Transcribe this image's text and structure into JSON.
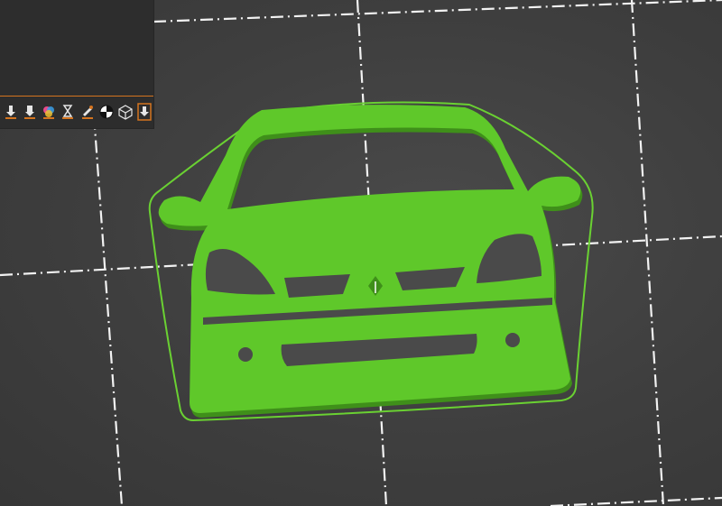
{
  "app": {
    "view": "3d-bed-preview"
  },
  "colors": {
    "background": "#3f3f3f",
    "grid": "#f2f2f2",
    "model": "#5fc82a",
    "model_shadow": "#3f8f1a",
    "outline": "#6ad132",
    "panel": "#2d2d2d",
    "accent": "#d4741f"
  },
  "toolbar": {
    "icons": [
      "download-icon",
      "support-paint-icon",
      "color-paint-icon",
      "timelapse-hourglass-icon",
      "seam-paint-icon",
      "balance-ball-icon",
      "wireframe-cube-icon",
      "export-upload-icon"
    ]
  }
}
